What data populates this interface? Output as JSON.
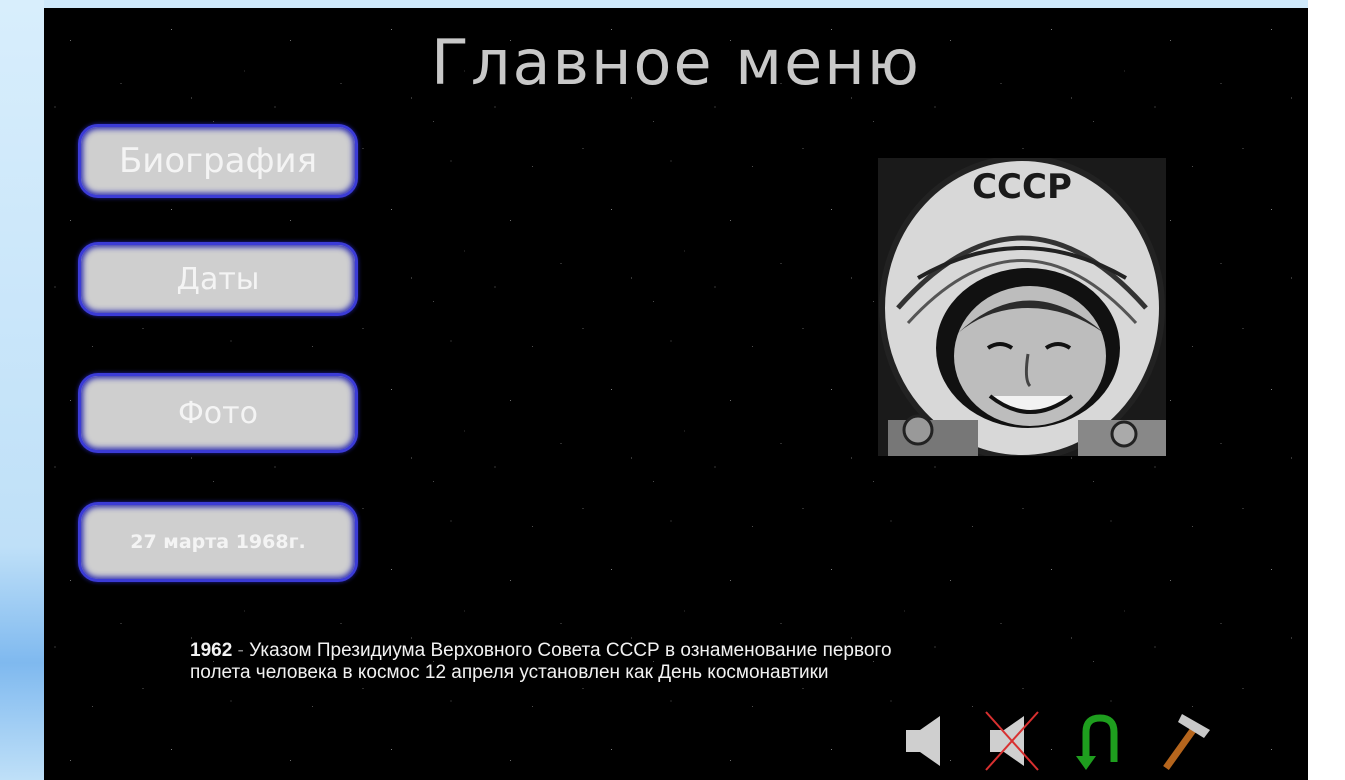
{
  "slide": {
    "title": "Главное меню"
  },
  "menu": {
    "biography_label": "Биография",
    "dates_label": "Даты",
    "photo_label": "Фото",
    "date_label": "27 марта 1968г."
  },
  "portrait": {
    "helmet_text": "СССР"
  },
  "caption": {
    "year": "1962",
    "dash": " - ",
    "line1": "Указом Президиума Верховного Совета СССР в ознаменование первого",
    "line2": "полета человека в космос 12 апреля установлен как День космонавтики"
  },
  "toolbar": {
    "icons": [
      "speaker-icon",
      "mute-icon",
      "return-icon",
      "hammer-icon"
    ]
  },
  "colors": {
    "slide_background": "#000000",
    "button_fill": "#cfcfcf",
    "button_border": "#3b3bd6",
    "title_color": "#c8c8c8",
    "return_icon": "#1e9e1e",
    "hammer_head": "#c8c8c8",
    "hammer_handle": "#b5651d",
    "mute_cross": "#d83030"
  }
}
